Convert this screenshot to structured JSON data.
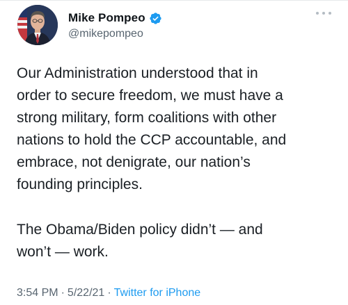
{
  "author": {
    "display_name": "Mike Pompeo",
    "handle": "@mikepompeo",
    "verified": true,
    "avatar": "profile-photo-with-flag"
  },
  "tweet": {
    "paragraphs": [
      "Our Administration understood that in\norder to secure freedom, we must have a\nstrong military, form coalitions with other\nnations to hold the CCP accountable, and\nembrace, not denigrate, our nation’s\nfounding principles.",
      "The Obama/Biden policy didn’t — and\nwon’t — work."
    ]
  },
  "meta": {
    "time": "3:54 PM",
    "separator": "·",
    "date": "5/22/21",
    "source": "Twitter for iPhone"
  },
  "icons": {
    "verified": "verified-badge-icon",
    "more": "more-options-icon"
  },
  "colors": {
    "verified_blue": "#1d9bf0",
    "link_blue": "#1d9bf0",
    "secondary_text": "#586570"
  }
}
